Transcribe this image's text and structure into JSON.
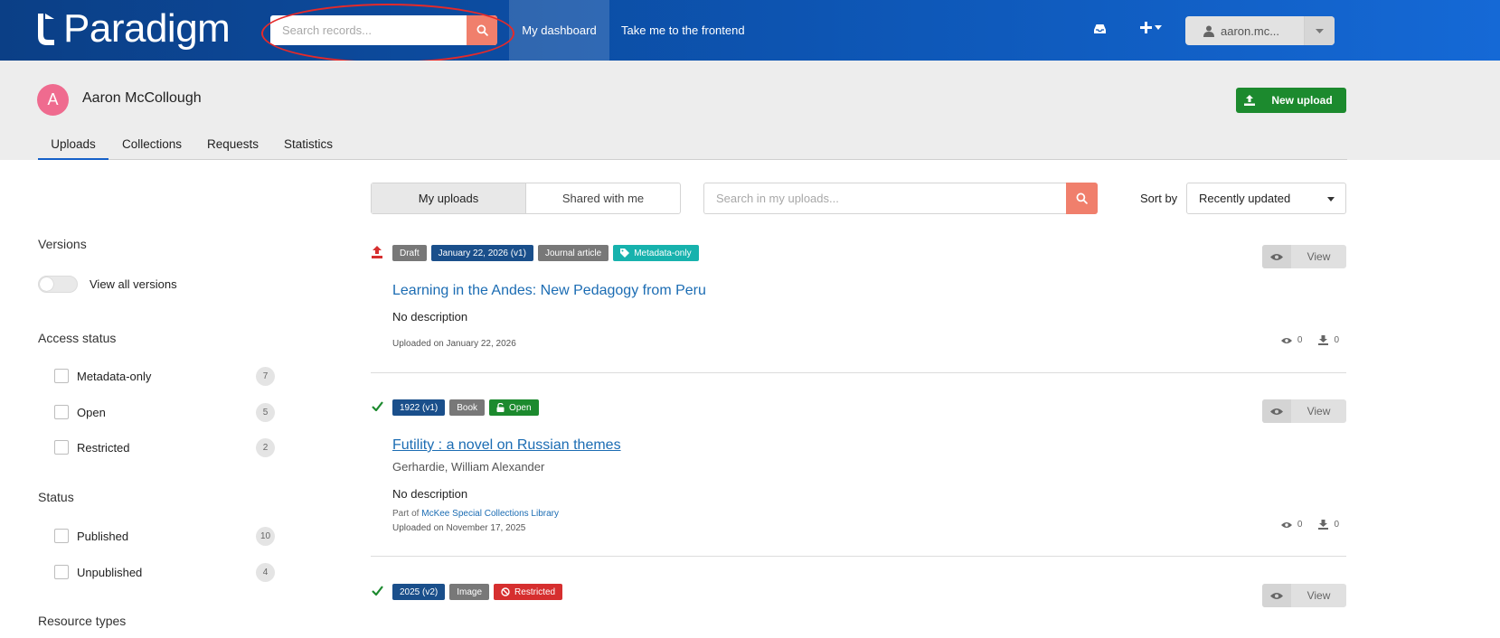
{
  "navbar": {
    "brand": "Paradigm",
    "search_placeholder": "Search records...",
    "links": [
      "My dashboard",
      "Take me to the frontend"
    ],
    "user_label": "aaron.mc..."
  },
  "profile": {
    "avatar_letter": "A",
    "name": "Aaron McCollough",
    "new_upload_label": "New upload"
  },
  "tabs": [
    "Uploads",
    "Collections",
    "Requests",
    "Statistics"
  ],
  "toolbar": {
    "toggle": [
      "My uploads",
      "Shared with me"
    ],
    "search_placeholder": "Search in my uploads...",
    "sort_label": "Sort by",
    "sort_value": "Recently updated"
  },
  "facets": {
    "versions": {
      "title": "Versions",
      "toggle_label": "View all versions"
    },
    "access": {
      "title": "Access status",
      "items": [
        {
          "label": "Metadata-only",
          "count": "7"
        },
        {
          "label": "Open",
          "count": "5"
        },
        {
          "label": "Restricted",
          "count": "2"
        }
      ]
    },
    "status": {
      "title": "Status",
      "items": [
        {
          "label": "Published",
          "count": "10"
        },
        {
          "label": "Unpublished",
          "count": "4"
        }
      ]
    },
    "resource_types": {
      "title": "Resource types"
    }
  },
  "records": [
    {
      "badges": [
        "Draft",
        "January 22, 2026 (v1)",
        "Journal article",
        "Metadata-only"
      ],
      "title": "Learning in the Andes: New Pedagogy from Peru",
      "description": "No description",
      "uploaded": "Uploaded on January 22, 2026",
      "views": "0",
      "downloads": "0",
      "view_label": "View"
    },
    {
      "badges": [
        "1922 (v1)",
        "Book",
        "Open"
      ],
      "title": "Futility : a novel on Russian themes",
      "author": "Gerhardie, William Alexander",
      "description": "No description",
      "part_of_prefix": "Part of",
      "part_of": "McKee Special Collections Library",
      "uploaded": "Uploaded on November 17, 2025",
      "views": "0",
      "downloads": "0",
      "view_label": "View"
    },
    {
      "badges": [
        "2025 (v2)",
        "Image",
        "Restricted"
      ],
      "view_label": "View"
    }
  ],
  "colors": {
    "navbar": "#0d55b3",
    "search_accent": "#f07f6c",
    "success": "#1c8a2e",
    "danger": "#d62f2f",
    "link": "#1b6cb3",
    "annotation": "#e42a2a"
  }
}
